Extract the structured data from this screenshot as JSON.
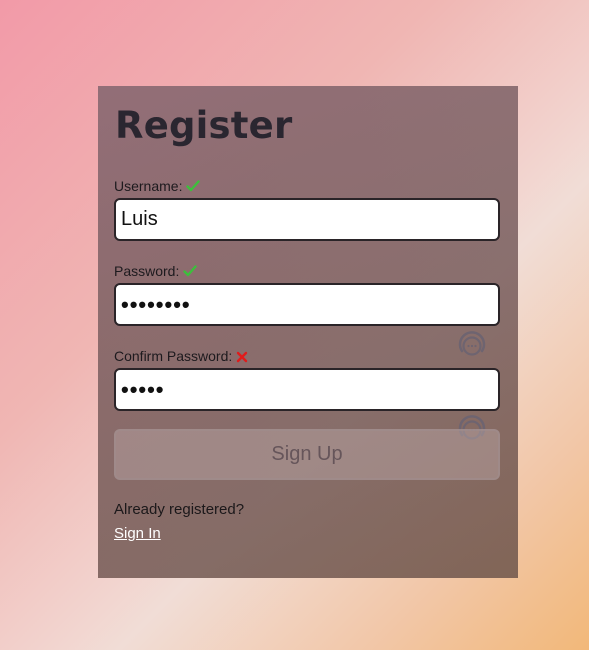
{
  "form": {
    "title": "Register",
    "username": {
      "label": "Username:",
      "value": "Luis",
      "status_icon": "check-icon"
    },
    "password": {
      "label": "Password:",
      "value": "••••••••",
      "status_icon": "check-icon"
    },
    "confirm_password": {
      "label": "Confirm Password:",
      "value": "•••••",
      "status_icon": "x-icon"
    },
    "submit_label": "Sign Up",
    "already_text": "Already registered?",
    "signin_label": "Sign In"
  },
  "colors": {
    "valid": "#3cbf3c",
    "invalid": "#e01b1b"
  }
}
